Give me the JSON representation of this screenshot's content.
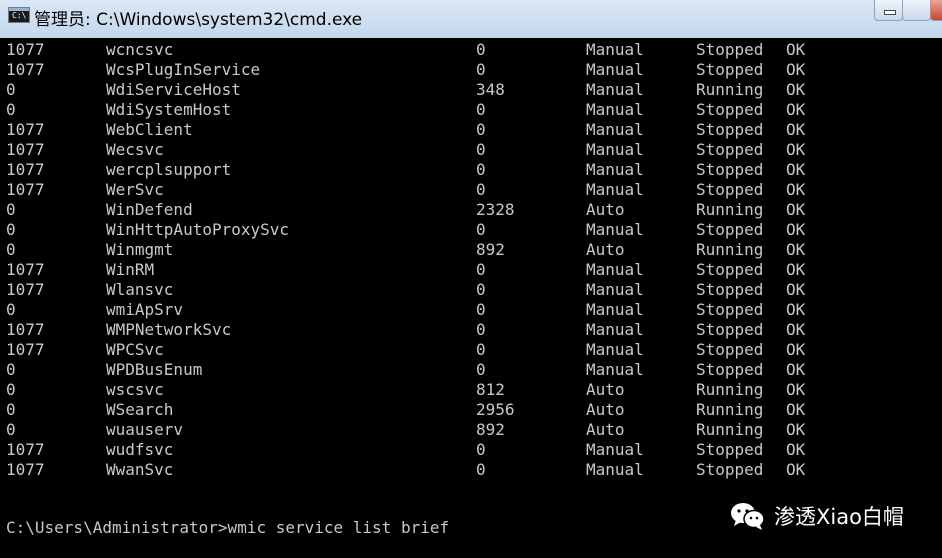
{
  "window": {
    "title": "管理员: C:\\Windows\\system32\\cmd.exe",
    "icon": "cmd-icon",
    "icon_prompt": "C:\\"
  },
  "services": [
    {
      "exit_code": "1077",
      "name": "wcncsvc",
      "pid": "0",
      "start_mode": "Manual",
      "state": "Stopped",
      "status": "OK"
    },
    {
      "exit_code": "1077",
      "name": "WcsPlugInService",
      "pid": "0",
      "start_mode": "Manual",
      "state": "Stopped",
      "status": "OK"
    },
    {
      "exit_code": "0",
      "name": "WdiServiceHost",
      "pid": "348",
      "start_mode": "Manual",
      "state": "Running",
      "status": "OK"
    },
    {
      "exit_code": "0",
      "name": "WdiSystemHost",
      "pid": "0",
      "start_mode": "Manual",
      "state": "Stopped",
      "status": "OK"
    },
    {
      "exit_code": "1077",
      "name": "WebClient",
      "pid": "0",
      "start_mode": "Manual",
      "state": "Stopped",
      "status": "OK"
    },
    {
      "exit_code": "1077",
      "name": "Wecsvc",
      "pid": "0",
      "start_mode": "Manual",
      "state": "Stopped",
      "status": "OK"
    },
    {
      "exit_code": "1077",
      "name": "wercplsupport",
      "pid": "0",
      "start_mode": "Manual",
      "state": "Stopped",
      "status": "OK"
    },
    {
      "exit_code": "1077",
      "name": "WerSvc",
      "pid": "0",
      "start_mode": "Manual",
      "state": "Stopped",
      "status": "OK"
    },
    {
      "exit_code": "0",
      "name": "WinDefend",
      "pid": "2328",
      "start_mode": "Auto",
      "state": "Running",
      "status": "OK"
    },
    {
      "exit_code": "0",
      "name": "WinHttpAutoProxySvc",
      "pid": "0",
      "start_mode": "Manual",
      "state": "Stopped",
      "status": "OK"
    },
    {
      "exit_code": "0",
      "name": "Winmgmt",
      "pid": "892",
      "start_mode": "Auto",
      "state": "Running",
      "status": "OK"
    },
    {
      "exit_code": "1077",
      "name": "WinRM",
      "pid": "0",
      "start_mode": "Manual",
      "state": "Stopped",
      "status": "OK"
    },
    {
      "exit_code": "1077",
      "name": "Wlansvc",
      "pid": "0",
      "start_mode": "Manual",
      "state": "Stopped",
      "status": "OK"
    },
    {
      "exit_code": "0",
      "name": "wmiApSrv",
      "pid": "0",
      "start_mode": "Manual",
      "state": "Stopped",
      "status": "OK"
    },
    {
      "exit_code": "1077",
      "name": "WMPNetworkSvc",
      "pid": "0",
      "start_mode": "Manual",
      "state": "Stopped",
      "status": "OK"
    },
    {
      "exit_code": "1077",
      "name": "WPCSvc",
      "pid": "0",
      "start_mode": "Manual",
      "state": "Stopped",
      "status": "OK"
    },
    {
      "exit_code": "0",
      "name": "WPDBusEnum",
      "pid": "0",
      "start_mode": "Manual",
      "state": "Stopped",
      "status": "OK"
    },
    {
      "exit_code": "0",
      "name": "wscsvc",
      "pid": "812",
      "start_mode": "Auto",
      "state": "Running",
      "status": "OK"
    },
    {
      "exit_code": "0",
      "name": "WSearch",
      "pid": "2956",
      "start_mode": "Auto",
      "state": "Running",
      "status": "OK"
    },
    {
      "exit_code": "0",
      "name": "wuauserv",
      "pid": "892",
      "start_mode": "Auto",
      "state": "Running",
      "status": "OK"
    },
    {
      "exit_code": "1077",
      "name": "wudfsvc",
      "pid": "0",
      "start_mode": "Manual",
      "state": "Stopped",
      "status": "OK"
    },
    {
      "exit_code": "1077",
      "name": "WwanSvc",
      "pid": "0",
      "start_mode": "Manual",
      "state": "Stopped",
      "status": "OK"
    }
  ],
  "prompt": "C:\\Users\\Administrator>wmic service list brief",
  "watermark": {
    "icon": "wechat-icon",
    "text": "渗透Xiao白帽"
  },
  "colors": {
    "terminal_bg": "#000000",
    "terminal_fg": "#c8c8c8",
    "titlebar": "#c2d6ec",
    "close_button": "#c8472f"
  }
}
